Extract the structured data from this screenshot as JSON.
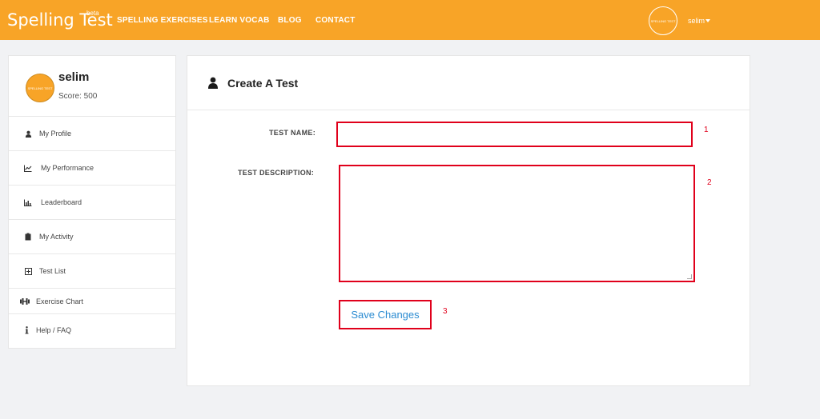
{
  "header": {
    "brand": "Spelling Test",
    "brand_beta": "beta",
    "nav": [
      {
        "label": "SPELLING EXERCISES"
      },
      {
        "label": "LEARN VOCAB"
      },
      {
        "label": "BLOG"
      },
      {
        "label": "CONTACT"
      }
    ],
    "avatar_text": "SPELLING TEST",
    "user_name": "selim"
  },
  "sidebar": {
    "avatar_text": "SPELLING TEST",
    "name": "selim",
    "score": "Score: 500",
    "items": [
      {
        "label": "My Profile",
        "icon": "user-icon"
      },
      {
        "label": "My Performance",
        "icon": "line-chart-icon"
      },
      {
        "label": "Leaderboard",
        "icon": "bar-chart-icon"
      },
      {
        "label": "My Activity",
        "icon": "clipboard-icon"
      },
      {
        "label": "Test List",
        "icon": "plus-square-icon"
      },
      {
        "label": "Exercise Chart",
        "icon": "dumbbell-icon"
      },
      {
        "label": "Help / FAQ",
        "icon": "info-icon"
      }
    ]
  },
  "form": {
    "title": "Create A Test",
    "test_name_label": "TEST NAME:",
    "test_name_value": "",
    "test_description_label": "TEST DESCRIPTION:",
    "test_description_value": "",
    "save_label": "Save Changes"
  },
  "annotations": [
    "1",
    "2",
    "3"
  ],
  "colors": {
    "brand": "#f8a427",
    "highlight": "#e0001b",
    "link": "#2b8bd1"
  }
}
